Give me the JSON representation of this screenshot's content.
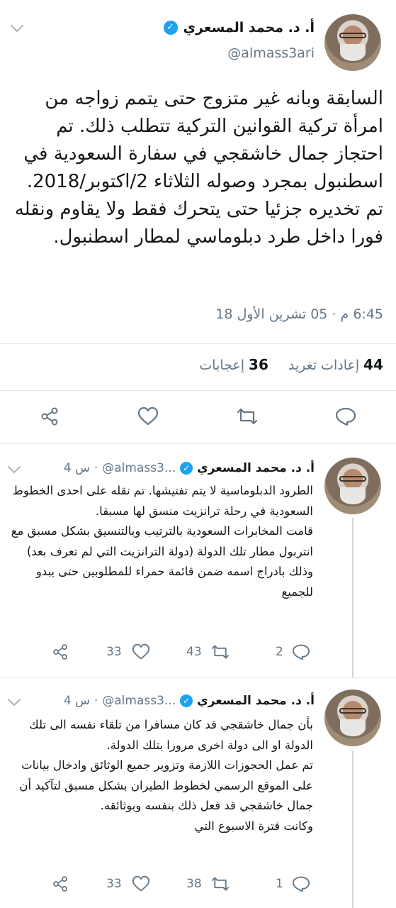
{
  "main": {
    "name": "أ. د. محمد المسعري",
    "handle": "@almass3ari",
    "text": "السابقة وبانه غير متزوج حتى يتمم زواجه من امرأة تركية القوانين  التركية تتطلب ذلك. تم احتجاز جمال خاشقجي في سفارة السعودية في اسطنبول  بمجرد وصوله الثلاثاء 2/اكتوبر/2018. تم تخديره جزئيا حتى يتحرك فقط ولا  يقاوم ونقله فورا داخل طرد دبلوماسي لمطار اسطنبول.",
    "time": "6:45 م · 05 تشرين الأول 18",
    "retweets_count": "44",
    "retweets_label": "إعادات تغريد",
    "likes_count": "36",
    "likes_label": "إعجابات"
  },
  "replies": [
    {
      "name": "أ. د. محمد المسعري",
      "handle": "@almass3...",
      "time": "4 س",
      "text": "الطرود الدبلوماسية لا  يتم تفتيشها. تم نقله على احدى الخطوط السعودية في رحلة ترانزيت منسق لها  مسبقا.\nقامت  المخابرات السعودية بالترتيب وبالتنسيق بشكل مسبق  مع انتربول مطار تلك  الدولة (دولة الترانزيت التي لم تعرف بعد) وذلك  بادراج اسمه ضمن قائمة  حمراء للمطلوبين حتى يبدو للجميع",
      "reply_count": "2",
      "retweet_count": "43",
      "like_count": "33"
    },
    {
      "name": "أ. د. محمد المسعري",
      "handle": "@almass3...",
      "time": "4 س",
      "text": "بأن جمال خاشقجي قد  كان مسافرا من تلقاء  نفسه الى تلك الدولة او الى دولة اخرى مرورا بتلك  الدولة.\nتم   عمل الحجوزات اللازمة وتزوير جميع الوثائق وادخال  بيانات على الموقع   الرسمي لخطوط الطيران بشكل مسبق لتآكيد أن جمال خاشقجي  قد فعل ذلك بنفسه    وبوثائقه.\nوكانت فترة الاسبوع التي",
      "reply_count": "1",
      "retweet_count": "38",
      "like_count": "33"
    }
  ],
  "colors": {
    "accent": "#1da1f2",
    "muted": "#657786",
    "border": "#e1e8ed"
  }
}
